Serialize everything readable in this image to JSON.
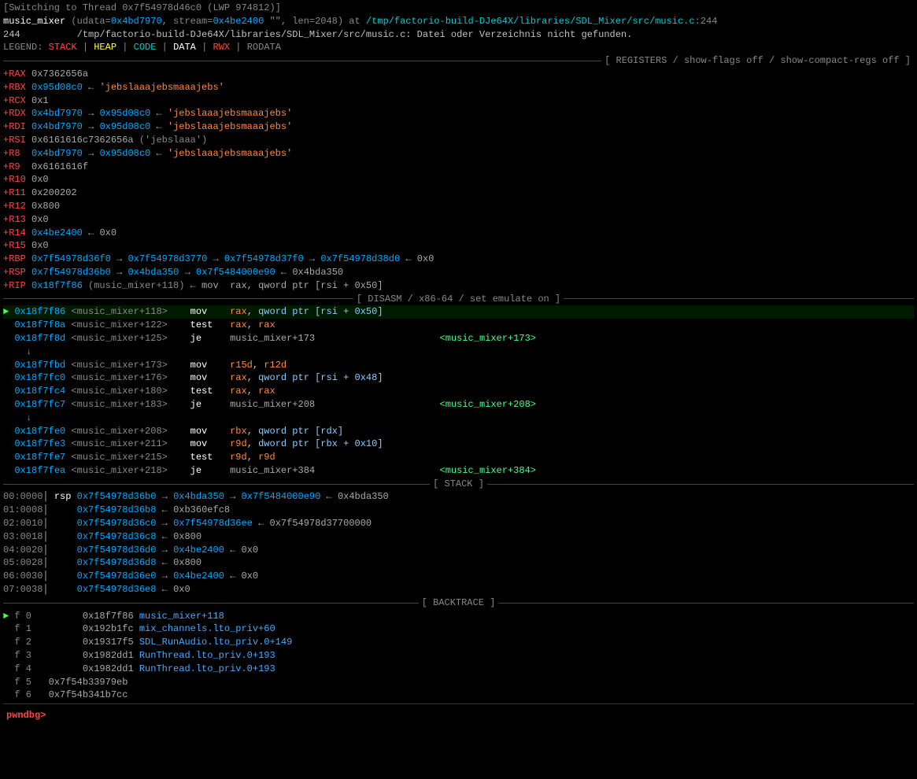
{
  "terminal": {
    "top_lines": [
      {
        "text": "[Switching to Thread 0x7f54978d46c0 (LWP 974812)]"
      },
      {
        "parts": [
          {
            "text": "music_mixer",
            "color": "white"
          },
          {
            "text": " (udata=",
            "color": "gray"
          },
          {
            "text": "0x4bd7970",
            "color": "addr"
          },
          {
            "text": ", stream=",
            "color": "gray"
          },
          {
            "text": "0x4be2400",
            "color": "addr"
          },
          {
            "text": " \"\", len=2048) at ",
            "color": "gray"
          },
          {
            "text": "/tmp/factorio-build-DJe64X/libraries/SDL_Mixer/src/music.c",
            "color": "cyan"
          },
          {
            "text": ":244",
            "color": "gray"
          }
        ]
      },
      {
        "text": "244          /tmp/factorio-build-DJe64X/libraries/SDL_Mixer/src/music.c: Datei oder Verzeichnis nicht gefunden."
      },
      {
        "parts": [
          {
            "text": "LEGEND: ",
            "color": "gray"
          },
          {
            "text": "STACK",
            "color": "red"
          },
          {
            "text": " | ",
            "color": "gray"
          },
          {
            "text": "HEAP",
            "color": "yellow"
          },
          {
            "text": " | ",
            "color": "gray"
          },
          {
            "text": "CODE",
            "color": "cyan"
          },
          {
            "text": " | ",
            "color": "gray"
          },
          {
            "text": "DATA",
            "color": "white"
          },
          {
            "text": " | ",
            "color": "gray"
          },
          {
            "text": "RWX",
            "color": "red"
          },
          {
            "text": " | ",
            "color": "gray"
          },
          {
            "text": "RODATA",
            "color": "gray"
          }
        ]
      }
    ],
    "registers_section": "REGISTERS / show-flags off / show-compact-regs off",
    "registers": [
      {
        "name": "+RAX",
        "value": "0x7362656a",
        "color": "white"
      },
      {
        "name": "+RBX",
        "value": "0x95d08c0",
        "arrow": "←",
        "str": "'jebslaaajebsmaaajebs'",
        "val_color": "addr"
      },
      {
        "name": "+RCX",
        "value": "0x1"
      },
      {
        "name": "+RDX",
        "value": "0x4bd7970",
        "arrow": "→",
        "dest": "0x95d08c0",
        "arrow2": "←",
        "str": "'jebslaaajebsmaaajebs'"
      },
      {
        "name": "+RDI",
        "value": "0x4bd7970",
        "arrow": "→",
        "dest": "0x95d08c0",
        "arrow2": "←",
        "str": "'jebslaaajebsmaaajebs'"
      },
      {
        "name": "+RSI",
        "value": "0x6161616c7362656a",
        "paren": "('jebslaaa')"
      },
      {
        "name": "+R8",
        "value": "0x4bd7970",
        "arrow": "→",
        "dest": "0x95d08c0",
        "arrow2": "←",
        "str": "'jebslaaajebsmaaajebs'"
      },
      {
        "name": "+R9",
        "value": "0x6161616f"
      },
      {
        "name": "+R10",
        "value": "0x0"
      },
      {
        "name": "+R11",
        "value": "0x200202"
      },
      {
        "name": "+R12",
        "value": "0x800"
      },
      {
        "name": "+R13",
        "value": "0x0"
      },
      {
        "name": "+R14",
        "value": "0x4be2400",
        "arrow": "←",
        "dest": "0x0"
      },
      {
        "name": "+R15",
        "value": "0x0"
      },
      {
        "name": "+RBP",
        "value": "0x7f54978d36f0",
        "arrow": "→",
        "v1": "0x7f54978d3770",
        "arrow2": "→",
        "v2": "0x7f54978d37f0",
        "arrow3": "→",
        "v3": "0x7f54978d38d0",
        "arrow4": "←",
        "v4": "0x0"
      },
      {
        "name": "+RSP",
        "value": "0x7f54978d36b0",
        "arrow": "→",
        "v1": "0x4bda350",
        "arrow2": "→",
        "v2": "0x7f5484000e90",
        "arrow3": "←",
        "v3": "0x4bda350"
      },
      {
        "name": "+RIP",
        "value": "0x18f7f86",
        "paren": "(music_mixer+118)",
        "rest": "← mov  rax, qword ptr [rsi + 0x50]"
      }
    ],
    "disasm_section": "DISASM / x86-64 / set emulate on",
    "disasm": [
      {
        "current": true,
        "addr": "0x18f7f86",
        "sym": "<music_mixer+118>",
        "op": "mov",
        "args": "rax, qword ptr [rsi + 0x50]",
        "highlight": true
      },
      {
        "addr": "0x18f7f8a",
        "sym": "<music_mixer+122>",
        "op": "test",
        "args": "rax, rax"
      },
      {
        "addr": "0x18f7f8d",
        "sym": "<music_mixer+125>",
        "op": "je",
        "args": "music_mixer+173",
        "target": "<music_mixer+173>"
      },
      {
        "addr": "",
        "arrow_down": true
      },
      {
        "addr": "0x18f7fbd",
        "sym": "<music_mixer+173>",
        "op": "mov",
        "args": "r15d, r12d"
      },
      {
        "addr": "0x18f7fc0",
        "sym": "<music_mixer+176>",
        "op": "mov",
        "args": "rax, qword ptr [rsi + 0x48]"
      },
      {
        "addr": "0x18f7fc4",
        "sym": "<music_mixer+180>",
        "op": "test",
        "args": "rax, rax"
      },
      {
        "addr": "0x18f7fc7",
        "sym": "<music_mixer+183>",
        "op": "je",
        "args": "music_mixer+208",
        "target": "<music_mixer+208>"
      },
      {
        "addr": "",
        "arrow_down": true
      },
      {
        "addr": "0x18f7fe0",
        "sym": "<music_mixer+208>",
        "op": "mov",
        "args": "rbx, qword ptr [rdx]"
      },
      {
        "addr": "0x18f7fe3",
        "sym": "<music_mixer+211>",
        "op": "mov",
        "args": "r9d, dword ptr [rbx + 0x10]"
      },
      {
        "addr": "0x18f7fe7",
        "sym": "<music_mixer+215>",
        "op": "test",
        "args": "r9d, r9d"
      },
      {
        "addr": "0x18f7fea",
        "sym": "<music_mixer+218>",
        "op": "je",
        "args": "music_mixer+384",
        "target": "<music_mixer+384>"
      }
    ],
    "stack_section": "STACK",
    "stack": [
      {
        "offset": "00:0000",
        "reg": "rsp",
        "addr": "0x7f54978d36b0",
        "arrow": "→",
        "v1": "0x4bda350",
        "arrow2": "→",
        "v2": "0x7f5484000e90",
        "arrow3": "←",
        "v3": "0x4bda350"
      },
      {
        "offset": "01:0008",
        "addr": "0x7f54978d36b8",
        "arrow": "←",
        "v1": "0xb360efc8"
      },
      {
        "offset": "02:0010",
        "addr": "0x7f54978d36c0",
        "arrow": "→",
        "v1": "0x7f54978d36ee",
        "arrow2": "←",
        "v2": "0x7f54978d37700000"
      },
      {
        "offset": "03:0018",
        "addr": "0x7f54978d36c8",
        "arrow": "←",
        "v1": "0x800"
      },
      {
        "offset": "04:0020",
        "addr": "0x7f54978d36d0",
        "arrow": "→",
        "v1": "0x4be2400",
        "arrow2": "←",
        "v2": "0x0"
      },
      {
        "offset": "05:0028",
        "addr": "0x7f54978d36d8",
        "arrow": "←",
        "v1": "0x800"
      },
      {
        "offset": "06:0030",
        "addr": "0x7f54978d36e0",
        "arrow": "→",
        "v1": "0x4be2400",
        "arrow2": "←",
        "v2": "0x0"
      },
      {
        "offset": "07:0038",
        "addr": "0x7f54978d36e8",
        "arrow": "←",
        "v1": "0x0"
      }
    ],
    "backtrace_section": "BACKTRACE",
    "backtrace": [
      {
        "frame": "f 0",
        "addr": "0x18f7f86",
        "func": "music_mixer+118"
      },
      {
        "frame": "f 1",
        "addr": "0x192b1fc",
        "func": "mix_channels.lto_priv+60"
      },
      {
        "frame": "f 2",
        "addr": "0x19317f5",
        "func": "SDL_RunAudio.lto_priv.0+149"
      },
      {
        "frame": "f 3",
        "addr": "0x1982dd1",
        "func": "RunThread.lto_priv.0+193"
      },
      {
        "frame": "f 4",
        "addr": "0x1982dd1",
        "func": "RunThread.lto_priv.0+193"
      },
      {
        "frame": "f 5",
        "addr": "0x7f54b33979eb",
        "func": ""
      },
      {
        "frame": "f 6",
        "addr": "0x7f54b341b7cc",
        "func": ""
      }
    ],
    "prompt": "pwndbg>"
  }
}
